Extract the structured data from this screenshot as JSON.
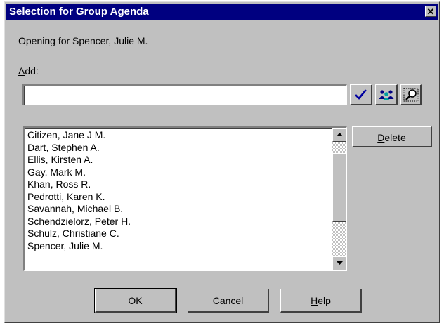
{
  "window": {
    "title": "Selection for Group Agenda",
    "close_glyph": "✕"
  },
  "opening_text": "Opening for Spencer, Julie M.",
  "add": {
    "label_mnemonic": "A",
    "label_rest": "dd:",
    "value": "",
    "placeholder": ""
  },
  "icons": {
    "confirm": "check-icon",
    "group": "group-icon",
    "search": "magnifier-icon"
  },
  "list": {
    "items": [
      "Citizen, Jane J M.",
      "Dart, Stephen A.",
      "Ellis, Kirsten A.",
      "Gay, Mark M.",
      "Khan, Ross R.",
      "Pedrotti, Karen K.",
      "Savannah, Michael B.",
      "Schendzielorz, Peter H.",
      "Schulz, Christiane C.",
      "Spencer, Julie M."
    ]
  },
  "buttons": {
    "delete_mnemonic": "D",
    "delete_rest": "elete",
    "ok": "OK",
    "cancel": "Cancel",
    "help_mnemonic": "H",
    "help_rest": "elp"
  },
  "colors": {
    "title_bar": "#000080",
    "dialog_face": "#c0c0c0",
    "check_blue": "#0000a0"
  }
}
